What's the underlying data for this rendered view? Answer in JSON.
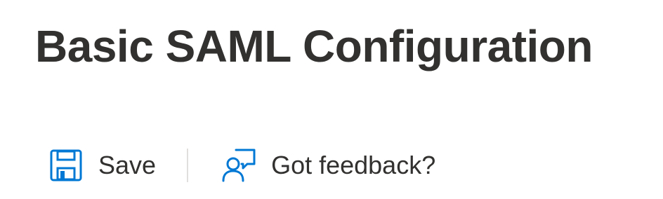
{
  "page": {
    "title": "Basic SAML Configuration"
  },
  "toolbar": {
    "save": {
      "label": "Save",
      "icon": "save-icon"
    },
    "feedback": {
      "label": "Got feedback?",
      "icon": "feedback-icon"
    }
  },
  "colors": {
    "text": "#323130",
    "accent": "#0078d4",
    "divider": "#e1dfdd"
  }
}
